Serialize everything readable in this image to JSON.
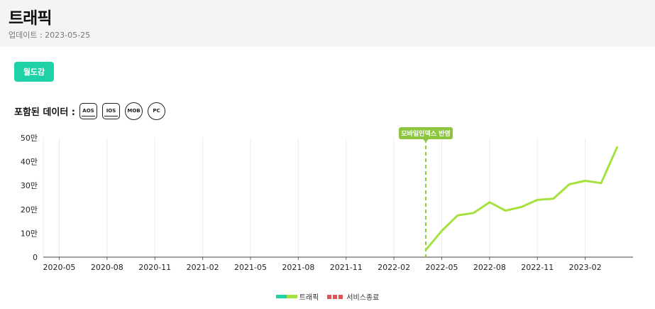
{
  "header": {
    "title": "트래픽",
    "updated": "업데이트 : 2023-05-25"
  },
  "tag_button": "월도감",
  "included_data": {
    "label": "포함된 데이터 :",
    "platforms": [
      "AOS",
      "IOS",
      "MOB",
      "PC"
    ]
  },
  "legend": {
    "traffic": "트래픽",
    "service_end": "서비스종료"
  },
  "colors": {
    "line": "#a6e23e",
    "accent": "#1ed1a6",
    "annotation": "#8cc63f",
    "service_end": "#e05454"
  },
  "chart_data": {
    "type": "line",
    "x_unit": "month",
    "xlim": [
      "2020-04",
      "2023-05"
    ],
    "ylim": [
      0,
      500000
    ],
    "y_ticks": [
      0,
      100000,
      200000,
      300000,
      400000,
      500000
    ],
    "y_tick_labels": [
      "0",
      "10만",
      "20만",
      "30만",
      "40만",
      "50만"
    ],
    "x_ticks": [
      "2020-05",
      "2020-08",
      "2020-11",
      "2021-02",
      "2021-05",
      "2021-08",
      "2021-11",
      "2022-02",
      "2022-05",
      "2022-08",
      "2022-11",
      "2023-02"
    ],
    "grid": "vertical",
    "legend_position": "bottom-center",
    "series": [
      {
        "name": "트래픽",
        "x": [
          "2022-04",
          "2022-05",
          "2022-06",
          "2022-07",
          "2022-08",
          "2022-09",
          "2022-10",
          "2022-11",
          "2022-12",
          "2023-01",
          "2023-02",
          "2023-03",
          "2023-04"
        ],
        "values": [
          30000,
          110000,
          175000,
          185000,
          230000,
          195000,
          210000,
          240000,
          245000,
          305000,
          320000,
          310000,
          460000
        ]
      }
    ],
    "annotations": [
      {
        "x": "2022-04",
        "label": "모바일인덱스 반영",
        "style": "dashed-vertical"
      }
    ]
  }
}
